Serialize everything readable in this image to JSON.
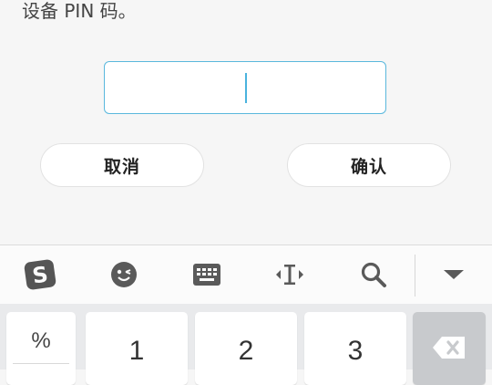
{
  "dialog": {
    "message": "设备 PIN 码。",
    "cancel_label": "取消",
    "confirm_label": "确认"
  },
  "keyboard": {
    "toolbar": {
      "icons": [
        "sogou-logo-icon",
        "emoji-icon",
        "keyboard-icon",
        "cursor-move-icon",
        "search-icon",
        "collapse-icon"
      ]
    },
    "keys": {
      "symbol": "%",
      "one": "1",
      "two": "2",
      "three": "3"
    }
  }
}
